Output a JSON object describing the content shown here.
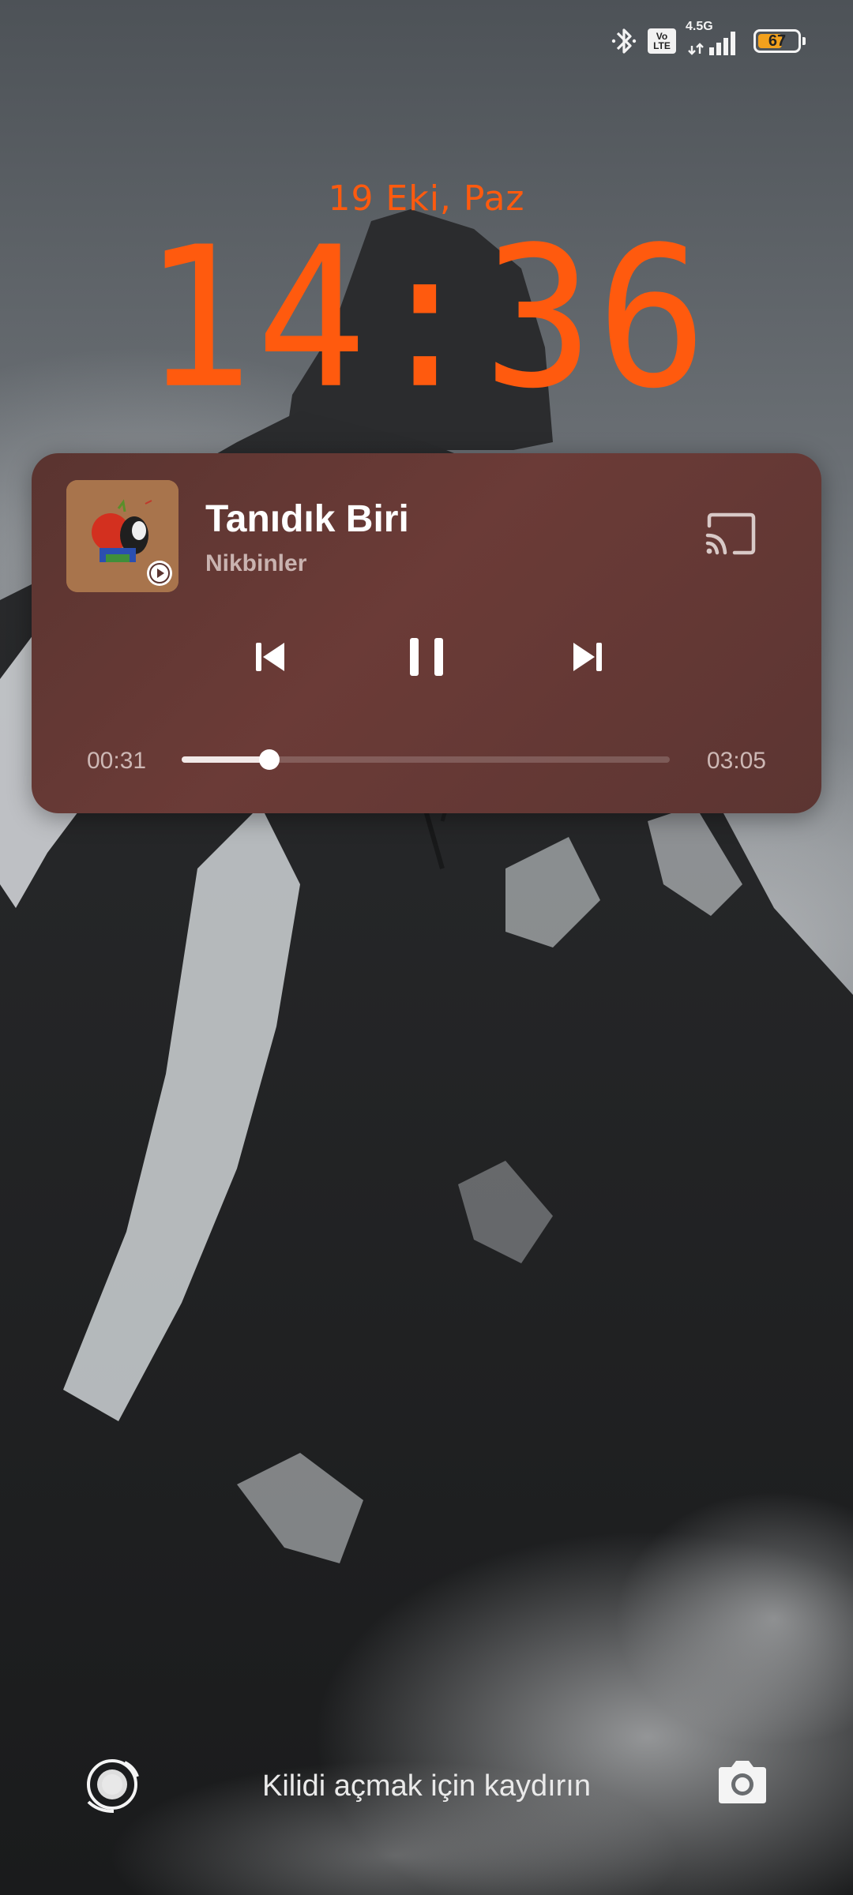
{
  "status_bar": {
    "icons": [
      "bluetooth-icon",
      "volte-icon",
      "signal-icon",
      "battery-icon"
    ],
    "volte_label_top": "Vo",
    "volte_label_bottom": "LTE",
    "network_type": "4.5G",
    "battery_percent": "67",
    "battery_level": 0.67,
    "battery_color": "#f3a11c"
  },
  "lockscreen": {
    "date": "19 Eki, Paz",
    "time": "14:36",
    "accent_color": "#ff5a0e"
  },
  "media_player": {
    "track_title": "Tanıdık Biri",
    "artist": "Nikbinler",
    "elapsed": "00:31",
    "duration": "03:05",
    "progress_fraction": 0.18,
    "icons": [
      "album-art",
      "cast-icon",
      "previous-icon",
      "pause-icon",
      "next-icon"
    ]
  },
  "bottom": {
    "unlock_hint": "Kilidi açmak için kaydırın",
    "icons": [
      "assistant-icon",
      "camera-icon"
    ]
  }
}
